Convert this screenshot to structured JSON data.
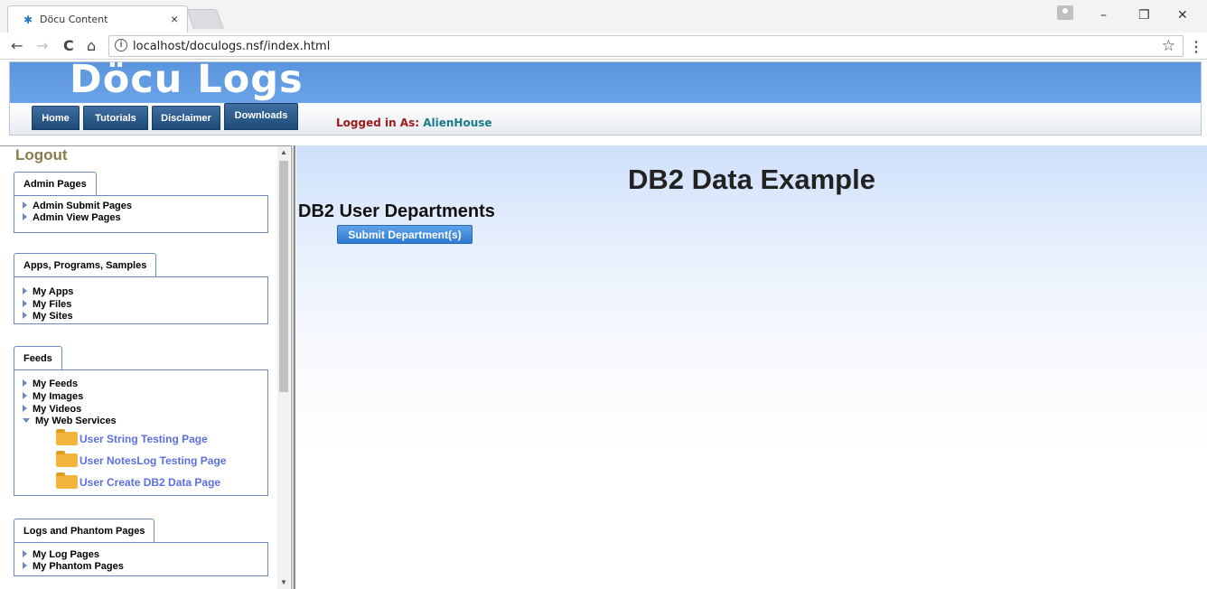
{
  "browser": {
    "tab_title": "Döcu Content",
    "tab_close": "×",
    "url": "localhost/doculogs.nsf/index.html",
    "nav": {
      "back": "←",
      "forward": "→",
      "reload": "C",
      "home": "⌂"
    },
    "window_buttons": {
      "minimize": "–",
      "restore": "❐",
      "close": "✕"
    },
    "star": "☆",
    "menu": "⋮"
  },
  "header": {
    "site_title": "Döcu Logs",
    "nav": [
      "Home",
      "Tutorials",
      "Disclaimer",
      "Downloads"
    ],
    "logged_in_label": "Logged in As:",
    "logged_in_user": "AlienHouse"
  },
  "sidebar": {
    "logout": "Logout",
    "sections": [
      {
        "title": "Admin Pages",
        "items": [
          "Admin Submit Pages",
          "Admin View Pages"
        ]
      },
      {
        "title": "Apps, Programs, Samples",
        "items": [
          "My Apps",
          "My Files",
          "My Sites"
        ]
      },
      {
        "title": "Feeds",
        "items": [
          "My Feeds",
          "My Images",
          "My Videos",
          "My Web Services"
        ],
        "sub_items": [
          "User String Testing Page",
          "User NotesLog Testing Page",
          "User Create DB2 Data Page"
        ]
      },
      {
        "title": "Logs and Phantom Pages",
        "items": [
          "My Log Pages",
          "My Phantom Pages"
        ]
      }
    ]
  },
  "main": {
    "title": "DB2 Data Example",
    "section_heading": "DB2 User Departments",
    "submit_button": "Submit Department(s)"
  }
}
